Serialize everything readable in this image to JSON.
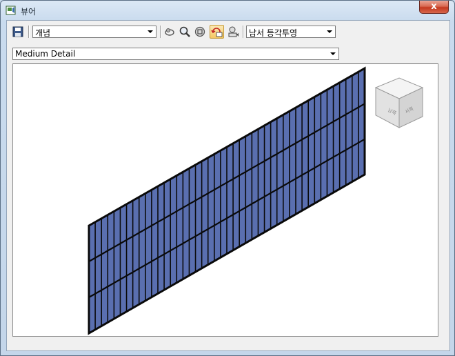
{
  "window": {
    "title": "뷰어",
    "close_label": "x"
  },
  "toolbar": {
    "visual_style": "개념",
    "view_orientation": "남서 등각투영"
  },
  "detail_level": "Medium Detail",
  "viewcube": {
    "left_face": "남쪽",
    "right_face": "서쪽"
  },
  "colors": {
    "panel_fill": "#5a6fb0",
    "mullion": "#0a0a0a",
    "viewport_bg": "#ffffff"
  }
}
